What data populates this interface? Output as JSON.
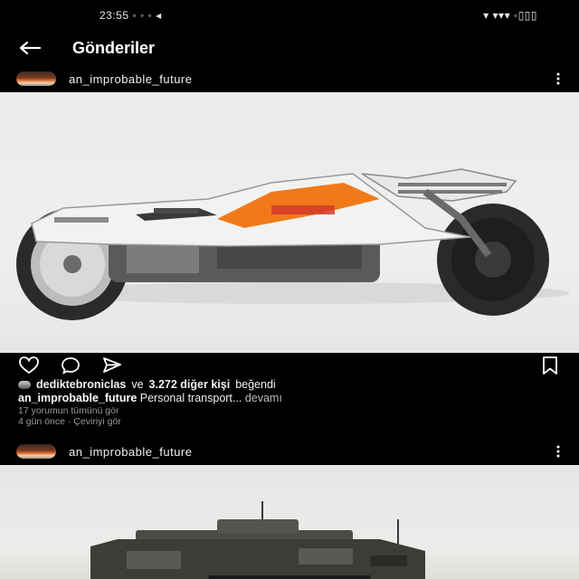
{
  "status_bar": {
    "time": "23:55 ◦ ◦ ◦ ◂",
    "indicators": "▾ ▾▾▾ ◦▯▯▯"
  },
  "nav": {
    "title": "Gönderiler",
    "back_icon": "arrow-left-icon"
  },
  "posts": [
    {
      "username": "an_improbable_future",
      "image_description": "futuristic-motorcycle",
      "actions": {
        "like_icon": "heart-icon",
        "comment_icon": "comment-icon",
        "share_icon": "send-icon",
        "save_icon": "bookmark-icon"
      },
      "likes": {
        "liked_by": "dediktebroniclas",
        "connector": "ve",
        "others": "3.272 diğer kişi",
        "suffix": "beğendi"
      },
      "caption": {
        "username": "an_improbable_future",
        "text": "Personal transport...",
        "more": "devamı"
      },
      "comments_link": "17 yorumun tümünü gör",
      "time_ago": "4 gün önce · Çeviriyi gör"
    },
    {
      "username": "an_improbable_future",
      "image_description": "armored-vehicle"
    }
  ],
  "colors": {
    "background": "#000000",
    "accent_orange": "#f07a1a",
    "image_bg": "#ebebea"
  }
}
